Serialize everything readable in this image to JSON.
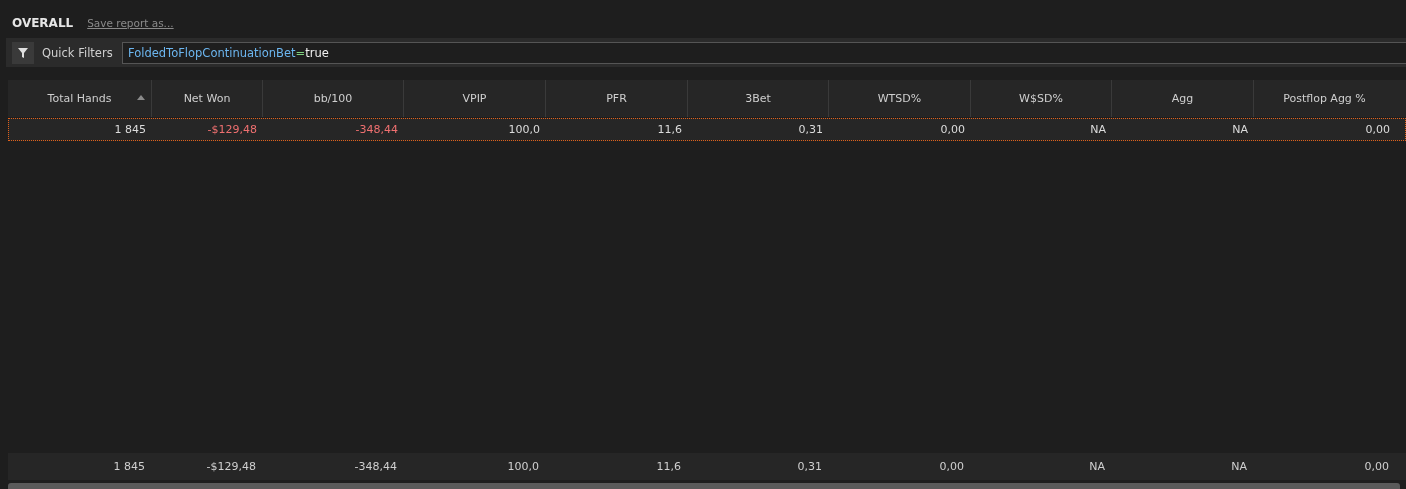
{
  "report": {
    "title": "OVERALL",
    "save_link": "Save report as..."
  },
  "quick_filters": {
    "label": "Quick Filters",
    "filter": {
      "key": "FoldedToFlopContinuationBet",
      "operator": "=",
      "value": "true"
    }
  },
  "table": {
    "columns": [
      {
        "label": "Total Hands",
        "sorted": true
      },
      {
        "label": "Net Won",
        "sorted": false
      },
      {
        "label": "bb/100",
        "sorted": false
      },
      {
        "label": "VPIP",
        "sorted": false
      },
      {
        "label": "PFR",
        "sorted": false
      },
      {
        "label": "3Bet",
        "sorted": false
      },
      {
        "label": "WTSD%",
        "sorted": false
      },
      {
        "label": "W$SD%",
        "sorted": false
      },
      {
        "label": "Agg",
        "sorted": false
      },
      {
        "label": "Postflop Agg %",
        "sorted": false
      }
    ],
    "rows": [
      {
        "selected": true,
        "cells": [
          {
            "text": "1 845",
            "negative": false
          },
          {
            "text": "-$129,48",
            "negative": true
          },
          {
            "text": "-348,44",
            "negative": true
          },
          {
            "text": "100,0",
            "negative": false
          },
          {
            "text": "11,6",
            "negative": false
          },
          {
            "text": "0,31",
            "negative": false
          },
          {
            "text": "0,00",
            "negative": false
          },
          {
            "text": "NA",
            "negative": false
          },
          {
            "text": "NA",
            "negative": false
          },
          {
            "text": "0,00",
            "negative": false
          }
        ]
      }
    ],
    "totals": [
      "1 845",
      "-$129,48",
      "-348,44",
      "100,0",
      "11,6",
      "0,31",
      "0,00",
      "NA",
      "NA",
      "0,00"
    ]
  }
}
